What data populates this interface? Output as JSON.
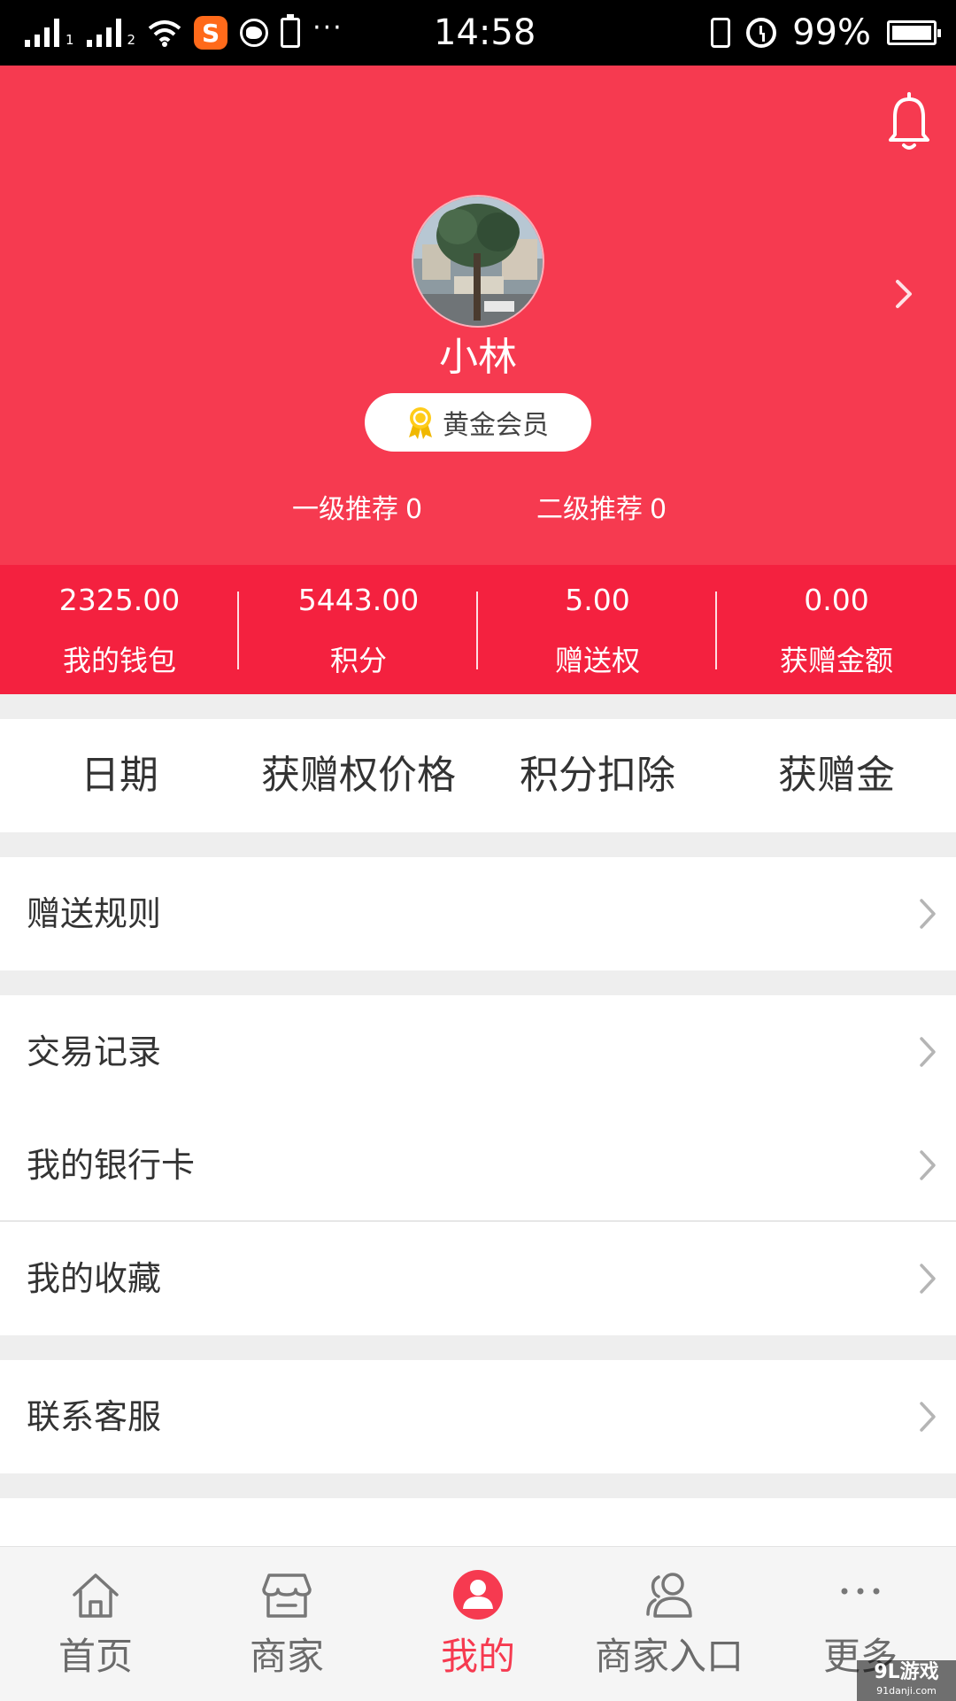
{
  "status_bar": {
    "sim1": "1",
    "sim2": "2",
    "app_badge": "S",
    "dots": "···",
    "time": "14:58",
    "battery_percent": "99%",
    "battery_level": 0.99
  },
  "profile": {
    "name": "小林",
    "member_level": "黄金会员",
    "referral_level1_label": "一级推荐",
    "referral_level1_count": "0",
    "referral_level2_label": "二级推荐",
    "referral_level2_count": "0"
  },
  "stats": [
    {
      "value": "2325.00",
      "label": "我的钱包"
    },
    {
      "value": "5443.00",
      "label": "积分"
    },
    {
      "value": "5.00",
      "label": "赠送权"
    },
    {
      "value": "0.00",
      "label": "获赠金额"
    }
  ],
  "table_header": {
    "columns": [
      "日期",
      "获赠权价格",
      "积分扣除",
      "获赠金"
    ]
  },
  "menu": {
    "rules": "赠送规则",
    "transactions": "交易记录",
    "bank_cards": "我的银行卡",
    "favorites": "我的收藏",
    "contact_service": "联系客服"
  },
  "bottom_nav": {
    "items": [
      {
        "label": "首页",
        "icon": "home-icon"
      },
      {
        "label": "商家",
        "icon": "store-icon"
      },
      {
        "label": "我的",
        "icon": "profile-icon",
        "active": true
      },
      {
        "label": "商家入口",
        "icon": "users-icon"
      },
      {
        "label": "更多",
        "icon": "more-icon"
      }
    ]
  },
  "watermark": {
    "main": "9L游戏",
    "sub": "91danji.com"
  },
  "colors": {
    "header_red": "#f63a50",
    "stats_red": "#f4213f",
    "active_tab": "#f63a50",
    "inactive_tab": "#6b6b6b"
  }
}
